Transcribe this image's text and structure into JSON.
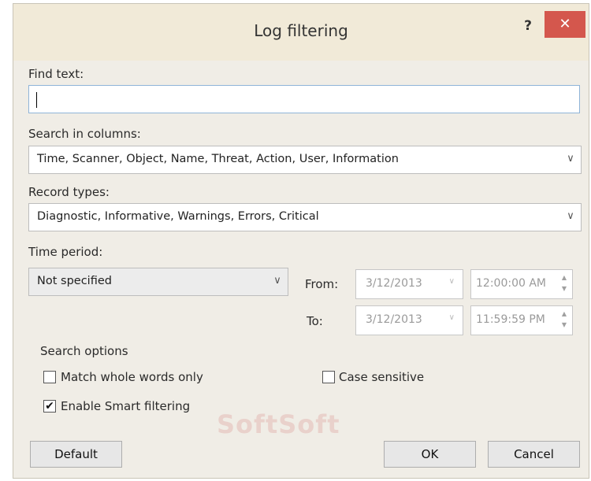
{
  "dialog": {
    "title": "Log filtering",
    "help_label": "?",
    "close_label": "✕"
  },
  "find_text": {
    "label": "Find text:",
    "value": ""
  },
  "search_columns": {
    "label": "Search in columns:",
    "value": "Time, Scanner, Object, Name, Threat, Action, User, Information"
  },
  "record_types": {
    "label": "Record types:",
    "value": "Diagnostic, Informative, Warnings, Errors, Critical"
  },
  "time_period": {
    "label": "Time period:",
    "value": "Not specified",
    "from_label": "From:",
    "from_date": "3/12/2013",
    "from_time": "12:00:00 AM",
    "to_label": "To:",
    "to_date": "3/12/2013",
    "to_time": "11:59:59 PM"
  },
  "search_options": {
    "label": "Search options",
    "match_whole_words": {
      "label": "Match whole words only",
      "checked": false
    },
    "case_sensitive": {
      "label": "Case sensitive",
      "checked": false
    },
    "smart_filtering": {
      "label": "Enable Smart filtering",
      "checked": true
    }
  },
  "buttons": {
    "default": "Default",
    "ok": "OK",
    "cancel": "Cancel"
  },
  "watermark": "SoftSoft",
  "icons": {
    "dropdown": "chevron-down-icon",
    "spin": "spin-updown-icon",
    "check": "checkmark-icon",
    "help": "question-icon",
    "close": "close-icon"
  },
  "colors": {
    "close_button": "#d4574d",
    "focus_border": "#8fb4d8"
  }
}
